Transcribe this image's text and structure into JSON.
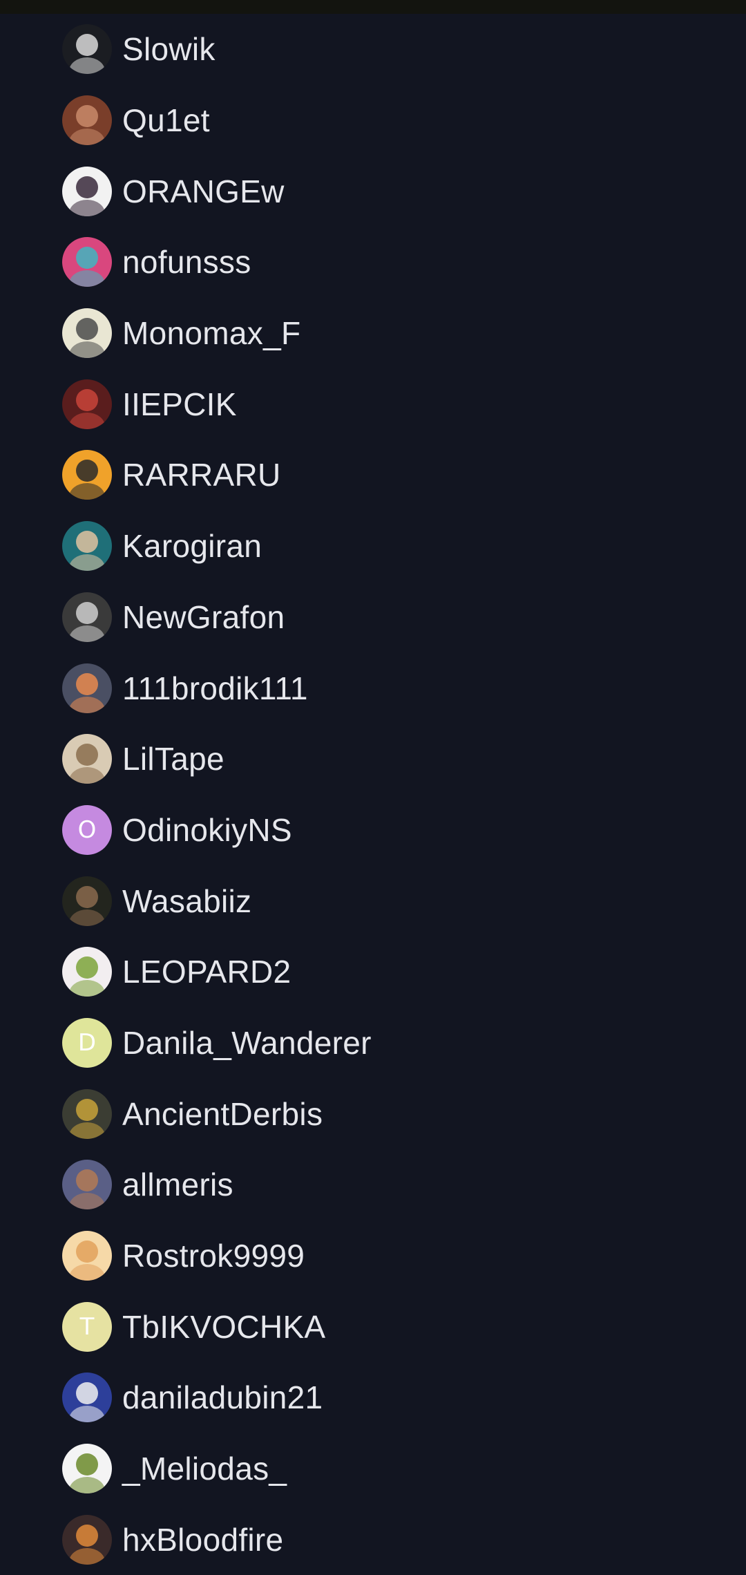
{
  "members": [
    {
      "name": "Slowik",
      "avatar": {
        "type": "image",
        "icon": "white-dragon-avatar",
        "bg": "#1b1d22",
        "fg": "#d9d9d9"
      }
    },
    {
      "name": "Qu1et",
      "avatar": {
        "type": "image",
        "icon": "man-face-avatar",
        "bg": "#7a3e2a",
        "fg": "#c98a6a"
      }
    },
    {
      "name": "ORANGEw",
      "avatar": {
        "type": "image",
        "icon": "dark-figure-avatar",
        "bg": "#f2f2f2",
        "fg": "#3a2a3c"
      }
    },
    {
      "name": "nofunsss",
      "avatar": {
        "type": "image",
        "icon": "anime-girl-avatar",
        "bg": "#d9477e",
        "fg": "#3fb6c0"
      }
    },
    {
      "name": "Monomax_F",
      "avatar": {
        "type": "image",
        "icon": "cartoon-cat-avatar",
        "bg": "#e9e6d3",
        "fg": "#4b4b4b"
      }
    },
    {
      "name": "IIEPCIK",
      "avatar": {
        "type": "image",
        "icon": "interpol-face-avatar",
        "bg": "#5a1d1d",
        "fg": "#c9443a"
      }
    },
    {
      "name": "RARRARU",
      "avatar": {
        "type": "image",
        "icon": "comic-hero-avatar",
        "bg": "#f0a22a",
        "fg": "#2a2a2a"
      }
    },
    {
      "name": "Karogiran",
      "avatar": {
        "type": "image",
        "icon": "pug-character-avatar",
        "bg": "#1f6f78",
        "fg": "#e0c3a0"
      }
    },
    {
      "name": "NewGrafon",
      "avatar": {
        "type": "image",
        "icon": "couple-photo-avatar",
        "bg": "#3a3a3a",
        "fg": "#cfcfcf"
      }
    },
    {
      "name": "111brodik111",
      "avatar": {
        "type": "image",
        "icon": "sunset-avatar",
        "bg": "#4a4f63",
        "fg": "#e98a4e"
      }
    },
    {
      "name": "LilTape",
      "avatar": {
        "type": "image",
        "icon": "dog-avatar",
        "bg": "#d9cbb4",
        "fg": "#8a6e4d"
      }
    },
    {
      "name": "OdinokiyNS",
      "avatar": {
        "type": "letter",
        "letter": "O",
        "bg": "#c58ae0",
        "fg": "#ffffff"
      }
    },
    {
      "name": "Wasabiiz",
      "avatar": {
        "type": "image",
        "icon": "soldier-face-avatar",
        "bg": "#23251e",
        "fg": "#8a6a4e"
      }
    },
    {
      "name": "LEOPARD2",
      "avatar": {
        "type": "image",
        "icon": "anime-character-avatar",
        "bg": "#f2eef0",
        "fg": "#7da33a"
      }
    },
    {
      "name": "Danila_Wanderer",
      "avatar": {
        "type": "letter",
        "letter": "D",
        "bg": "#dfe59a",
        "fg": "#ffffff"
      }
    },
    {
      "name": "AncientDerbis",
      "avatar": {
        "type": "image",
        "icon": "yellow-object-avatar",
        "bg": "#3b3d33",
        "fg": "#c8a23a"
      }
    },
    {
      "name": "allmeris",
      "avatar": {
        "type": "image",
        "icon": "girl-portrait-avatar",
        "bg": "#5a5f86",
        "fg": "#b37a55"
      }
    },
    {
      "name": "Rostrok9999",
      "avatar": {
        "type": "image",
        "icon": "blonde-anime-avatar",
        "bg": "#f6d9a8",
        "fg": "#e2a15c"
      }
    },
    {
      "name": "TbIKVOCHKA",
      "avatar": {
        "type": "letter",
        "letter": "T",
        "bg": "#e6e2a2",
        "fg": "#ffffff"
      }
    },
    {
      "name": "daniladubin21",
      "avatar": {
        "type": "image",
        "icon": "mouse-ban-avatar",
        "bg": "#2d3f9a",
        "fg": "#f0f0f0"
      }
    },
    {
      "name": "_Meliodas_",
      "avatar": {
        "type": "image",
        "icon": "shrek-avatar",
        "bg": "#f4f4f4",
        "fg": "#6b8a2a"
      }
    },
    {
      "name": "hxBloodfire",
      "avatar": {
        "type": "image",
        "icon": "fox-character-avatar",
        "bg": "#3a2a2a",
        "fg": "#e08a3a"
      }
    }
  ]
}
